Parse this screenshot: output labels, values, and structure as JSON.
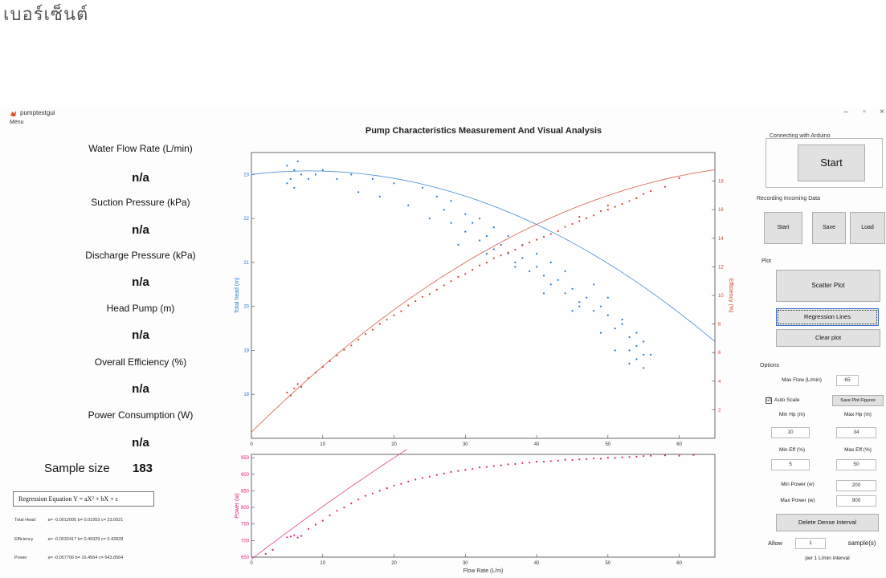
{
  "doc_heading": "เบอร์เซ็นต์",
  "window": {
    "title": "pumptestgui",
    "menu": "Menu",
    "controls": {
      "minimize": "–",
      "maximize": "▫",
      "close": "×"
    }
  },
  "readouts": [
    {
      "label": "Water Flow Rate (L/min)",
      "value": "n/a"
    },
    {
      "label": "Suction Pressure (kPa)",
      "value": "n/a"
    },
    {
      "label": "Discharge Pressure (kPa)",
      "value": "n/a"
    },
    {
      "label": "Head Pump (m)",
      "value": "n/a"
    },
    {
      "label": "Overall Efficiency (%)",
      "value": "n/a"
    },
    {
      "label": "Power Consumption (W)",
      "value": "n/a"
    }
  ],
  "sample": {
    "label": "Sample size",
    "value": "183"
  },
  "regression": {
    "equation_label": "Regression Equation Y = aX² + bX + c",
    "rows": [
      {
        "name": "Total Head",
        "coefs": "a= -0.0012005 b= 0.01953 c= 23.0021"
      },
      {
        "name": "Efficiency",
        "coefs": "a= -0.0032417 b= 0.49329 c= 0.42828"
      },
      {
        "name": "Power",
        "coefs": "a= -0.057706 b= 16.4564 c= 643.8564"
      }
    ]
  },
  "plot": {
    "title": "Pump Characteristics Measurement And Visual Analysis"
  },
  "chart_data": [
    {
      "type": "scatter",
      "title": "Pump Characteristics Measurement And Visual Analysis",
      "xlabel": "",
      "ylabel": "Total head (m)",
      "y2label": "Efficiency (%)",
      "xlim": [
        0,
        65
      ],
      "ylim": [
        17,
        23.5
      ],
      "y2lim": [
        0,
        20
      ],
      "x_ticks": [
        0,
        10,
        20,
        30,
        40,
        50,
        60
      ],
      "y_ticks": [
        18,
        19,
        20,
        21,
        22,
        23
      ],
      "y2_ticks": [
        2,
        4,
        6,
        8,
        10,
        12,
        14,
        16,
        18
      ],
      "series": [
        {
          "axis": "left",
          "color": "#1f77d4",
          "regression": {
            "a": -0.0012005,
            "b": 0.01953,
            "c": 23.0021
          },
          "points": [
            [
              5,
              23.2
            ],
            [
              6,
              23.1
            ],
            [
              6.5,
              23.3
            ],
            [
              5.5,
              22.9
            ],
            [
              7,
              23.0
            ],
            [
              6,
              22.7
            ],
            [
              5,
              22.8
            ],
            [
              12,
              22.9
            ],
            [
              15,
              22.6
            ],
            [
              18,
              22.5
            ],
            [
              22,
              22.3
            ],
            [
              25,
              22.0
            ],
            [
              27,
              22.2
            ],
            [
              28,
              21.9
            ],
            [
              30,
              21.7
            ],
            [
              31,
              21.9
            ],
            [
              32,
              21.5
            ],
            [
              33,
              21.6
            ],
            [
              34,
              21.3
            ],
            [
              35,
              21.4
            ],
            [
              36,
              21.2
            ],
            [
              37,
              20.9
            ],
            [
              38,
              21.1
            ],
            [
              39,
              20.8
            ],
            [
              40,
              20.9
            ],
            [
              41,
              20.7
            ],
            [
              42,
              20.5
            ],
            [
              43,
              20.6
            ],
            [
              44,
              20.3
            ],
            [
              45,
              20.4
            ],
            [
              46,
              20.1
            ],
            [
              47,
              20.2
            ],
            [
              48,
              19.9
            ],
            [
              49,
              20.0
            ],
            [
              50,
              19.8
            ],
            [
              51,
              19.5
            ],
            [
              52,
              19.6
            ],
            [
              53,
              19.3
            ],
            [
              54,
              19.1
            ],
            [
              55,
              18.9
            ],
            [
              55,
              19.2
            ],
            [
              54,
              18.8
            ],
            [
              53,
              19.0
            ],
            [
              52,
              19.7
            ],
            [
              50,
              20.2
            ],
            [
              48,
              20.5
            ],
            [
              46,
              20.0
            ],
            [
              44,
              20.8
            ],
            [
              42,
              21.0
            ],
            [
              40,
              21.2
            ],
            [
              38,
              21.4
            ],
            [
              36,
              21.6
            ],
            [
              34,
              21.8
            ],
            [
              32,
              22.0
            ],
            [
              30,
              22.1
            ],
            [
              28,
              22.4
            ],
            [
              26,
              22.5
            ],
            [
              24,
              22.7
            ],
            [
              20,
              22.8
            ],
            [
              17,
              22.9
            ],
            [
              14,
              23.0
            ],
            [
              10,
              23.1
            ],
            [
              9,
              23.0
            ],
            [
              8,
              22.9
            ],
            [
              29,
              21.4
            ],
            [
              33,
              21.2
            ],
            [
              37,
              21.0
            ],
            [
              41,
              20.3
            ],
            [
              45,
              19.9
            ],
            [
              49,
              19.4
            ],
            [
              51,
              19.0
            ],
            [
              53,
              18.7
            ],
            [
              55,
              18.6
            ],
            [
              56,
              18.9
            ],
            [
              54,
              19.4
            ]
          ]
        },
        {
          "axis": "right",
          "color": "#d4422a",
          "regression": {
            "a": -0.0032417,
            "b": 0.49329,
            "c": 0.42828
          },
          "points": [
            [
              5,
              3.2
            ],
            [
              6,
              3.5
            ],
            [
              5.5,
              3.0
            ],
            [
              6.5,
              3.8
            ],
            [
              7,
              3.6
            ],
            [
              10,
              5.0
            ],
            [
              12,
              5.8
            ],
            [
              14,
              6.5
            ],
            [
              16,
              7.3
            ],
            [
              18,
              8.0
            ],
            [
              20,
              8.6
            ],
            [
              22,
              9.3
            ],
            [
              24,
              9.9
            ],
            [
              26,
              10.4
            ],
            [
              28,
              11.0
            ],
            [
              30,
              11.5
            ],
            [
              32,
              12.1
            ],
            [
              34,
              12.6
            ],
            [
              36,
              13.0
            ],
            [
              38,
              13.5
            ],
            [
              40,
              13.9
            ],
            [
              42,
              14.3
            ],
            [
              44,
              14.8
            ],
            [
              46,
              15.2
            ],
            [
              48,
              15.6
            ],
            [
              50,
              16.0
            ],
            [
              52,
              16.4
            ],
            [
              54,
              16.8
            ],
            [
              55,
              17.1
            ],
            [
              53,
              16.6
            ],
            [
              51,
              16.2
            ],
            [
              49,
              15.9
            ],
            [
              47,
              15.4
            ],
            [
              45,
              15.0
            ],
            [
              43,
              14.5
            ],
            [
              41,
              14.1
            ],
            [
              39,
              13.7
            ],
            [
              37,
              13.2
            ],
            [
              35,
              12.8
            ],
            [
              33,
              12.3
            ],
            [
              31,
              11.8
            ],
            [
              29,
              11.3
            ],
            [
              27,
              10.7
            ],
            [
              25,
              10.1
            ],
            [
              23,
              9.6
            ],
            [
              21,
              8.9
            ],
            [
              19,
              8.3
            ],
            [
              17,
              7.6
            ],
            [
              15,
              6.9
            ],
            [
              13,
              6.2
            ],
            [
              11,
              5.4
            ],
            [
              9,
              4.6
            ],
            [
              8,
              4.2
            ],
            [
              60,
              18.2
            ],
            [
              58,
              17.6
            ],
            [
              56,
              17.3
            ],
            [
              50,
              16.3
            ],
            [
              46,
              15.5
            ]
          ]
        }
      ]
    },
    {
      "type": "scatter",
      "xlabel": "Flow Rate (L/m)",
      "ylabel": "Power (w)",
      "xlim": [
        0,
        65
      ],
      "ylim": [
        650,
        960
      ],
      "x_ticks": [
        0,
        10,
        20,
        30,
        40,
        50,
        60
      ],
      "y_ticks": [
        650,
        700,
        750,
        800,
        850,
        900,
        950
      ],
      "series": [
        {
          "axis": "left",
          "color": "#e0207a",
          "regression": {
            "a": -0.057706,
            "b": 16.4564,
            "c": 643.8564
          },
          "points": [
            [
              2,
              660
            ],
            [
              3,
              672
            ],
            [
              5,
              710
            ],
            [
              5.5,
              712
            ],
            [
              6,
              716
            ],
            [
              6.5,
              709
            ],
            [
              7,
              714
            ],
            [
              10,
              760
            ],
            [
              12,
              790
            ],
            [
              14,
              812
            ],
            [
              16,
              835
            ],
            [
              18,
              850
            ],
            [
              20,
              866
            ],
            [
              22,
              878
            ],
            [
              24,
              889
            ],
            [
              26,
              898
            ],
            [
              28,
              907
            ],
            [
              30,
              913
            ],
            [
              32,
              921
            ],
            [
              34,
              925
            ],
            [
              36,
              930
            ],
            [
              38,
              934
            ],
            [
              40,
              938
            ],
            [
              42,
              940
            ],
            [
              44,
              944
            ],
            [
              46,
              945
            ],
            [
              48,
              948
            ],
            [
              50,
              950
            ],
            [
              52,
              951
            ],
            [
              54,
              953
            ],
            [
              55,
              955
            ],
            [
              56,
              956
            ],
            [
              58,
              957
            ],
            [
              60,
              956
            ],
            [
              62,
              958
            ],
            [
              53,
              952
            ],
            [
              51,
              949
            ],
            [
              49,
              947
            ],
            [
              47,
              946
            ],
            [
              45,
              943
            ],
            [
              43,
              941
            ],
            [
              41,
              938
            ],
            [
              39,
              935
            ],
            [
              37,
              931
            ],
            [
              35,
              927
            ],
            [
              33,
              922
            ],
            [
              31,
              916
            ],
            [
              29,
              910
            ],
            [
              27,
              902
            ],
            [
              25,
              893
            ],
            [
              23,
              884
            ],
            [
              21,
              871
            ],
            [
              19,
              858
            ],
            [
              17,
              842
            ],
            [
              15,
              824
            ],
            [
              13,
              800
            ],
            [
              11,
              776
            ],
            [
              9,
              748
            ],
            [
              8,
              735
            ]
          ]
        }
      ]
    }
  ],
  "right_panel": {
    "connect_group": "Connecting with Arduino",
    "connect_start": "Start",
    "record_group": "Recording Incoming Data",
    "record_start": "Start",
    "record_save": "Save",
    "record_load": "Load",
    "plot_group": "Plot",
    "scatter_plot": "Scatter Plot",
    "regression_lines": "Regression Lines",
    "clear_plot": "Clear plot",
    "options_group": "Options",
    "max_flow_label": "Max Flow (L/min)",
    "max_flow_value": "65",
    "auto_scale_label": "Auto Scale",
    "auto_scale_checked": "☑",
    "save_plot_figures": "Save Plot Figures",
    "min_hp_label": "Min Hp (m)",
    "max_hp_label": "Max Hp (m)",
    "min_hp_value": "10",
    "max_hp_value": "34",
    "min_eff_label": "Min Eff (%)",
    "max_eff_label": "Max Eff (%)",
    "min_eff_value": "5",
    "max_eff_value": "50",
    "min_power_label": "Min Power (w)",
    "min_power_value": "200",
    "max_power_label": "Max Power (w)",
    "max_power_value": "900",
    "delete_dense": "Delete Dense Interval",
    "allow_label": "Allow",
    "allow_value": "1",
    "samples_label": "sample(s)",
    "per_interval_label": "per 1 L/min interval"
  }
}
